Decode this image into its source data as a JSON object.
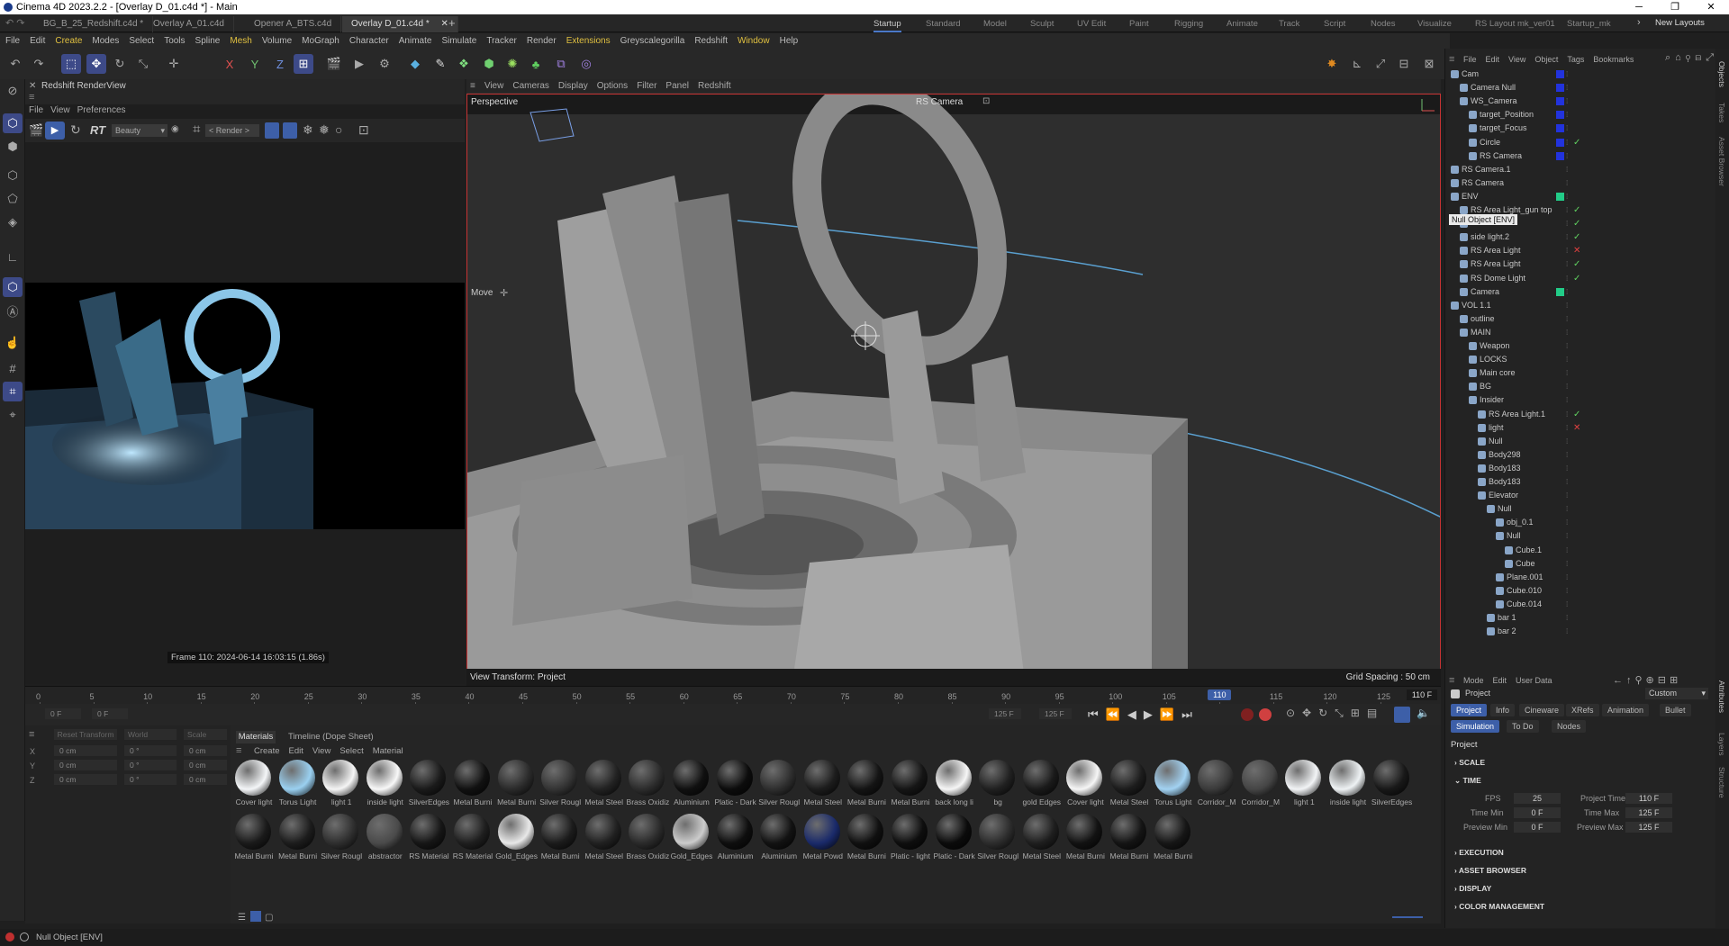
{
  "window": {
    "title": "Cinema 4D 2023.2.2 - [Overlay D_01.c4d *] - Main"
  },
  "doc_tabs": [
    {
      "label": "BG_B_25_Redshift.c4d *",
      "active": false
    },
    {
      "label": "Overlay A_01.c4d",
      "active": false
    },
    {
      "label": "Opener A_BTS.c4d",
      "active": false
    },
    {
      "label": "Overlay D_01.c4d *",
      "active": true
    }
  ],
  "layouts": [
    "Startup",
    "Standard",
    "Model",
    "Sculpt",
    "UV Edit",
    "Paint",
    "Rigging",
    "Animate",
    "Track",
    "Script",
    "Nodes",
    "Visualize",
    "RS Layout mk_ver01",
    "Startup_mk"
  ],
  "new_layouts": "New Layouts",
  "menu": [
    "File",
    "Edit",
    "Create",
    "Modes",
    "Select",
    "Tools",
    "Spline",
    "Mesh",
    "Volume",
    "MoGraph",
    "Character",
    "Animate",
    "Simulate",
    "Tracker",
    "Render",
    "Extensions",
    "Greyscalegorilla",
    "Redshift",
    "Window",
    "Help"
  ],
  "renderview": {
    "title": "Redshift RenderView",
    "menu": [
      "File",
      "View",
      "Preferences"
    ],
    "rt": "RT",
    "aov": "Beauty",
    "render_mode": "< Render >",
    "status": "Frame  110:  2024-06-14  16:03:15  (1.86s)"
  },
  "viewport": {
    "menu": [
      "View",
      "Cameras",
      "Display",
      "Options",
      "Filter",
      "Panel",
      "Redshift"
    ],
    "view_name": "Perspective",
    "camera": "RS Camera",
    "tool": "Move",
    "view_transform": "View Transform: Project",
    "grid_spacing": "Grid Spacing : 50 cm"
  },
  "timeline": {
    "ticks": [
      "0",
      "5",
      "10",
      "15",
      "20",
      "25",
      "30",
      "35",
      "40",
      "45",
      "50",
      "55",
      "60",
      "65",
      "70",
      "75",
      "80",
      "85",
      "90",
      "95",
      "100",
      "105",
      "110",
      "115",
      "120",
      "125"
    ],
    "current_label": "110",
    "current_frame": 110,
    "end": "110 F",
    "start_field": "0 F",
    "start_field2": "0 F",
    "end_field": "125 F",
    "end_field2": "125 F"
  },
  "coords": {
    "headers": [
      "Reset Transform",
      "World",
      "Scale"
    ],
    "rows": [
      {
        "axis": "X",
        "pos": "0 cm",
        "rot": "0 °",
        "scale": "0 cm"
      },
      {
        "axis": "Y",
        "pos": "0 cm",
        "rot": "0 °",
        "scale": "0 cm"
      },
      {
        "axis": "Z",
        "pos": "0 cm",
        "rot": "0 °",
        "scale": "0 cm"
      }
    ]
  },
  "materials": {
    "tabs": [
      "Materials",
      "Timeline (Dope Sheet)"
    ],
    "menu": [
      "Create",
      "Edit",
      "View",
      "Select",
      "Material"
    ],
    "row1": [
      {
        "name": "Cover light",
        "color": "#f4f6f8"
      },
      {
        "name": "Torus Light",
        "color": "#9ad0f0"
      },
      {
        "name": "light 1",
        "color": "#f5f5f5"
      },
      {
        "name": "inside light",
        "color": "#f8f8f8"
      },
      {
        "name": "SilverEdges",
        "color": "#1a1a1a"
      },
      {
        "name": "Metal Burni",
        "color": "#111111"
      },
      {
        "name": "Metal Burni",
        "color": "#2a2a2a"
      },
      {
        "name": "Silver Rougl",
        "color": "#333333"
      },
      {
        "name": "Metal Steel",
        "color": "#222222"
      },
      {
        "name": "Brass Oxidiz",
        "color": "#2c2c2c"
      },
      {
        "name": "Aluminium",
        "color": "#101010"
      },
      {
        "name": "Platic - Dark",
        "color": "#0c0c0c"
      },
      {
        "name": "Silver Rougl",
        "color": "#2e2e2e"
      },
      {
        "name": "Metal Steel",
        "color": "#1c1c1c"
      },
      {
        "name": "Metal Burni",
        "color": "#141414"
      },
      {
        "name": "Metal Burni",
        "color": "#151515"
      },
      {
        "name": "back long li",
        "color": "#f6f6f6"
      },
      {
        "name": "bg",
        "color": "#202020"
      },
      {
        "name": "gold Edges",
        "color": "#1a1a1a"
      },
      {
        "name": "Cover light",
        "color": "#f6f6f6"
      },
      {
        "name": "Metal Steel",
        "color": "#1c1c1c"
      },
      {
        "name": "Torus Light",
        "color": "#a2d2f2"
      },
      {
        "name": "Corridor_M",
        "color": "#3a3a3a"
      },
      {
        "name": "Corridor_M",
        "color": "#454545"
      },
      {
        "name": "light 1",
        "color": "#f2f4f6"
      },
      {
        "name": "inside light",
        "color": "#eef2f4"
      },
      {
        "name": "SilverEdges",
        "color": "#181818"
      }
    ],
    "row2": [
      {
        "name": "Metal Burni",
        "color": "#1a1a1a"
      },
      {
        "name": "Metal Burni",
        "color": "#1c1c1c"
      },
      {
        "name": "Silver Rougl",
        "color": "#2e2e2e"
      },
      {
        "name": "abstractor",
        "color": "#4a4a4a"
      },
      {
        "name": "RS Material",
        "color": "#161616"
      },
      {
        "name": "RS Material",
        "color": "#1e1e1e"
      },
      {
        "name": "Gold_Edges",
        "color": "#e8e8e8"
      },
      {
        "name": "Metal Burni",
        "color": "#1b1b1b"
      },
      {
        "name": "Metal Steel",
        "color": "#202020"
      },
      {
        "name": "Brass Oxidiz",
        "color": "#2a2a2a"
      },
      {
        "name": "Gold_Edges",
        "color": "#cccccc"
      },
      {
        "name": "Aluminium",
        "color": "#0e0e0e"
      },
      {
        "name": "Aluminium",
        "color": "#121212"
      },
      {
        "name": "Metal Powd",
        "color": "#1a2a6a"
      },
      {
        "name": "Metal Burni",
        "color": "#101010"
      },
      {
        "name": "Platic - light",
        "color": "#0e0e0e"
      },
      {
        "name": "Platic - Dark",
        "color": "#0b0b0b"
      },
      {
        "name": "Silver Rougl",
        "color": "#2c2c2c"
      },
      {
        "name": "Metal Steel",
        "color": "#1e1e1e"
      },
      {
        "name": "Metal Burni",
        "color": "#121212"
      },
      {
        "name": "Metal Burni",
        "color": "#141414"
      },
      {
        "name": "Metal Burni",
        "color": "#161616"
      }
    ]
  },
  "objects": {
    "menu": [
      "File",
      "Edit",
      "View",
      "Object",
      "Tags",
      "Bookmarks"
    ],
    "tooltip": "Null Object [ENV]",
    "items": [
      {
        "name": "Cam",
        "depth": 0,
        "color": "#2233dd",
        "check": ""
      },
      {
        "name": "Camera Null",
        "depth": 1,
        "color": "#2233dd",
        "check": ""
      },
      {
        "name": "WS_Camera",
        "depth": 1,
        "color": "#2233dd",
        "check": ""
      },
      {
        "name": "target_Position",
        "depth": 2,
        "color": "#2233dd",
        "check": ""
      },
      {
        "name": "target_Focus",
        "depth": 2,
        "color": "#2233dd",
        "check": ""
      },
      {
        "name": "Circle",
        "depth": 2,
        "color": "#2233dd",
        "check": "✓"
      },
      {
        "name": "RS Camera",
        "depth": 2,
        "color": "#2233dd",
        "check": ""
      },
      {
        "name": "RS Camera.1",
        "depth": 0,
        "color": "",
        "check": ""
      },
      {
        "name": "RS Camera",
        "depth": 0,
        "color": "",
        "check": ""
      },
      {
        "name": "ENV",
        "depth": 0,
        "color": "#22cc88",
        "check": ""
      },
      {
        "name": "RS Area Light_gun top",
        "depth": 1,
        "color": "",
        "check": "✓"
      },
      {
        "name": "",
        "depth": 1,
        "color": "",
        "check": "✓"
      },
      {
        "name": "side light.2",
        "depth": 1,
        "color": "",
        "check": "✓"
      },
      {
        "name": "RS Area Light",
        "depth": 1,
        "color": "",
        "check": "✕"
      },
      {
        "name": "RS Area Light",
        "depth": 1,
        "color": "",
        "check": "✓"
      },
      {
        "name": "RS Dome Light",
        "depth": 1,
        "color": "",
        "check": "✓"
      },
      {
        "name": "Camera",
        "depth": 1,
        "color": "#22cc88",
        "check": ""
      },
      {
        "name": "VOL 1.1",
        "depth": 0,
        "color": "",
        "check": ""
      },
      {
        "name": "outline",
        "depth": 1,
        "color": "",
        "check": ""
      },
      {
        "name": "MAIN",
        "depth": 1,
        "color": "",
        "check": ""
      },
      {
        "name": "Weapon",
        "depth": 2,
        "color": "",
        "check": ""
      },
      {
        "name": "LOCKS",
        "depth": 2,
        "color": "",
        "check": ""
      },
      {
        "name": "Main core",
        "depth": 2,
        "color": "",
        "check": ""
      },
      {
        "name": "BG",
        "depth": 2,
        "color": "",
        "check": ""
      },
      {
        "name": "Insider",
        "depth": 2,
        "color": "",
        "check": ""
      },
      {
        "name": "RS Area Light.1",
        "depth": 3,
        "color": "",
        "check": "✓"
      },
      {
        "name": "light",
        "depth": 3,
        "color": "",
        "check": "✕"
      },
      {
        "name": "Null",
        "depth": 3,
        "color": "",
        "check": ""
      },
      {
        "name": "Body298",
        "depth": 3,
        "color": "",
        "check": ""
      },
      {
        "name": "Body183",
        "depth": 3,
        "color": "",
        "check": ""
      },
      {
        "name": "Body183",
        "depth": 3,
        "color": "",
        "check": ""
      },
      {
        "name": "Elevator",
        "depth": 3,
        "color": "",
        "check": ""
      },
      {
        "name": "Null",
        "depth": 4,
        "color": "",
        "check": ""
      },
      {
        "name": "obj_0.1",
        "depth": 5,
        "color": "",
        "check": ""
      },
      {
        "name": "Null",
        "depth": 5,
        "color": "",
        "check": ""
      },
      {
        "name": "Cube.1",
        "depth": 6,
        "color": "",
        "check": ""
      },
      {
        "name": "Cube",
        "depth": 6,
        "color": "",
        "check": ""
      },
      {
        "name": "Plane.001",
        "depth": 5,
        "color": "",
        "check": ""
      },
      {
        "name": "Cube.010",
        "depth": 5,
        "color": "",
        "check": ""
      },
      {
        "name": "Cube.014",
        "depth": 5,
        "color": "",
        "check": ""
      },
      {
        "name": "bar 1",
        "depth": 4,
        "color": "",
        "check": ""
      },
      {
        "name": "bar 2",
        "depth": 4,
        "color": "",
        "check": ""
      }
    ]
  },
  "attributes": {
    "menu": [
      "Mode",
      "Edit",
      "User Data"
    ],
    "object": "Project",
    "preset": "Custom",
    "tabs": [
      "Project",
      "Info",
      "Cineware",
      "XRefs",
      "Animation",
      "Bullet"
    ],
    "tabs2": [
      "Simulation",
      "To Do",
      "Nodes"
    ],
    "heading": "Project",
    "sections": [
      "SCALE",
      "TIME",
      "EXECUTION",
      "ASSET BROWSER",
      "DISPLAY",
      "COLOR MANAGEMENT"
    ],
    "time": {
      "fps_label": "FPS",
      "fps": "25",
      "project_time_label": "Project Time",
      "project_time": "110 F",
      "min_label": "Time Min",
      "min": "0 F",
      "max_label": "Time Max",
      "max": "125 F",
      "pmin_label": "Preview Min",
      "pmin": "0 F",
      "pmax_label": "Preview Max",
      "pmax": "125 F"
    }
  },
  "side_tabs": [
    "Objects",
    "Takes",
    "Asset Browser"
  ],
  "side_tabs2": [
    "Attributes",
    "Layers",
    "Structure"
  ],
  "status": "Null Object [ENV]",
  "colors": {
    "accent": "#3d5fa8",
    "viewport_border": "#c53232",
    "timeline_cursor": "#4a78c8"
  }
}
